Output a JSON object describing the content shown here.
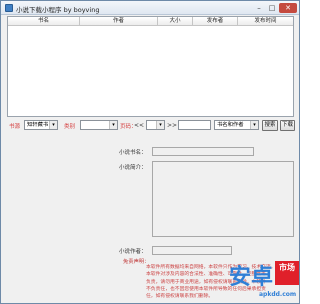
{
  "window": {
    "title": "小说下载小程序  by boyving",
    "min_glyph": "–",
    "max_glyph": "□",
    "close_glyph": "✕"
  },
  "list": {
    "columns": [
      "书名",
      "作者",
      "大小",
      "发布者",
      "发布时间"
    ]
  },
  "filters": {
    "source_label": "书源",
    "source_value": "知轩藏书",
    "category_label": "类别",
    "category_value": "",
    "page_label": "页码：",
    "prev_glyph": "<<",
    "page_value": "",
    "next_glyph": ">>",
    "search_placeholder": "",
    "sort_value": "书名和作者",
    "search_label": "搜索",
    "download_label": "下载"
  },
  "details": {
    "name_label": "小说书名：",
    "intro_label": "小说简介：",
    "author_label": "小说作者：",
    "notice_title": "免责声明：",
    "notice_lines": [
      "本软件所有数据均来自网络，本软件只作为学习、技术交流。",
      "本软件对涉及内容的合法性、准确性、可靠性、完整性等",
      "负责，请勿用于商业用途，如有侵权请联系删除，本软件",
      "不负责任，也不因您使用本软件所导致的任何后果承担责",
      "任，如有侵权请联系我们删除。"
    ]
  },
  "watermark": {
    "big_text": "安卓",
    "badge_text": "市场",
    "site_text": "apkdd.com"
  },
  "colors": {
    "accent_red": "#d43b3b",
    "watermark_blue": "#2f7fd6"
  }
}
